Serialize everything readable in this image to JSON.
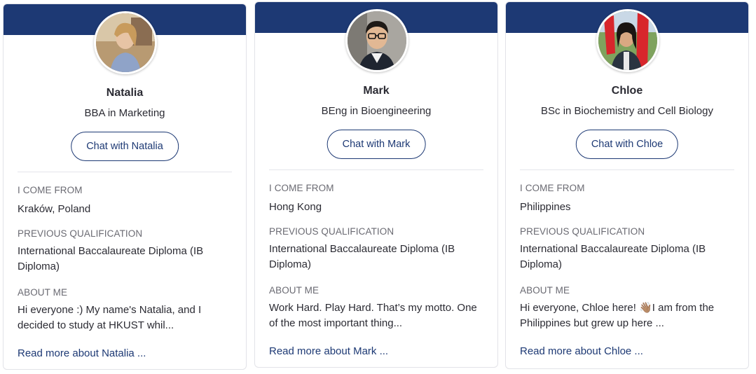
{
  "colors": {
    "band": "#1d3974",
    "accent": "#1d3974",
    "label": "#6a6a72"
  },
  "section_labels": {
    "from": "I COME FROM",
    "qualification": "PREVIOUS QUALIFICATION",
    "about": "ABOUT ME"
  },
  "cards": [
    {
      "name": "Natalia",
      "degree": "BBA in Marketing",
      "chat_label": "Chat with Natalia",
      "from": "Kraków, Poland",
      "qualification": "International Baccalaureate Diploma (IB Diploma)",
      "about": "Hi everyone :) My name's Natalia, and I decided to study at HKUST whil...",
      "read_more": "Read more about Natalia ..."
    },
    {
      "name": "Mark",
      "degree": "BEng in Bioengineering",
      "chat_label": "Chat with Mark",
      "from": "Hong Kong",
      "qualification": "International Baccalaureate Diploma (IB Diploma)",
      "about": "Work Hard. Play Hard. That’s my motto. One of the most important thing...",
      "read_more": "Read more about Mark ..."
    },
    {
      "name": "Chloe",
      "degree": "BSc in Biochemistry and Cell Biology",
      "chat_label": "Chat with Chloe",
      "from": "Philippines",
      "qualification": "International Baccalaureate Diploma (IB Diploma)",
      "about": "Hi everyone, Chloe here! 👋🏽I am from the Philippines but grew up here ...",
      "read_more": "Read more about Chloe ..."
    }
  ]
}
